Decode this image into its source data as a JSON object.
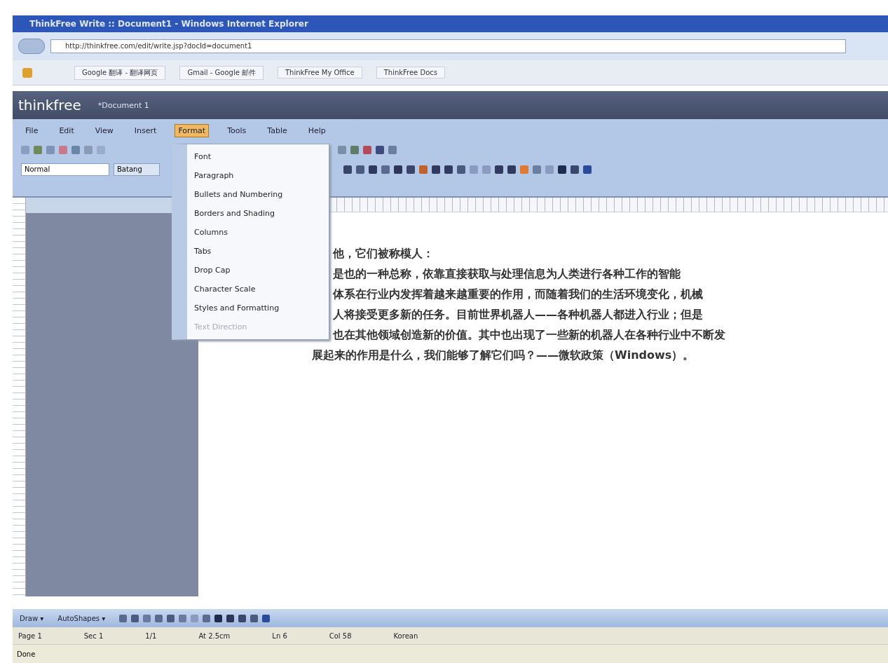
{
  "browser": {
    "title": "ThinkFree Write :: Document1 - Windows Internet Explorer",
    "address": "http://thinkfree.com/edit/write.jsp?docId=document1",
    "favorites": [
      "Google 翻译 - 翻译网页",
      "Gmail - Google 邮件",
      "ThinkFree My Office",
      "ThinkFree Docs"
    ]
  },
  "app": {
    "logo": "thinkfree",
    "document_title": "*Document 1"
  },
  "menu_bar": [
    {
      "label": "File",
      "selected": false
    },
    {
      "label": "Edit",
      "selected": false
    },
    {
      "label": "View",
      "selected": false
    },
    {
      "label": "Insert",
      "selected": false
    },
    {
      "label": "Format",
      "selected": true
    },
    {
      "label": "Tools",
      "selected": false
    },
    {
      "label": "Table",
      "selected": false
    },
    {
      "label": "Help",
      "selected": false
    }
  ],
  "format_menu": [
    {
      "label": "Font",
      "disabled": false
    },
    {
      "label": "Paragraph",
      "disabled": false
    },
    {
      "label": "Bullets and Numbering",
      "disabled": false
    },
    {
      "label": "Borders and Shading",
      "disabled": false
    },
    {
      "label": "Columns",
      "disabled": false
    },
    {
      "label": "Tabs",
      "disabled": false
    },
    {
      "label": "Drop Cap",
      "disabled": false
    },
    {
      "label": "Character Scale",
      "disabled": false
    },
    {
      "label": "Styles and Formatting",
      "disabled": false
    },
    {
      "label": "Text Direction",
      "disabled": true
    }
  ],
  "toolbar": {
    "style": "Normal",
    "font": "Batang"
  },
  "document": {
    "lines": [
      "他，它们被称模人：",
      "是也的一种总称，依靠直接获取与处理信息为人类进行各种工作的智能",
      "体系在行业内发挥着越来越重要的作用，而随着我们的生活环境变化，机械",
      "人将接受更多新的任务。目前世界机器人——各种机器人都进入行业；但是",
      "也在其他领域创造新的价值。其中也出现了一些新的机器人在各种行业中不断发",
      "展起来的作用是什么，我们能够了解它们吗？——微软政策（Windows）。"
    ]
  },
  "drawing_toolbar": {
    "draw": "Draw ▾",
    "autoshapes": "AutoShapes ▾"
  },
  "status_bar": [
    "Page 1",
    "Sec 1",
    "1/1",
    "At 2.5cm",
    "Ln 6",
    "Col 58",
    "Korean"
  ],
  "browser_status": "Done"
}
